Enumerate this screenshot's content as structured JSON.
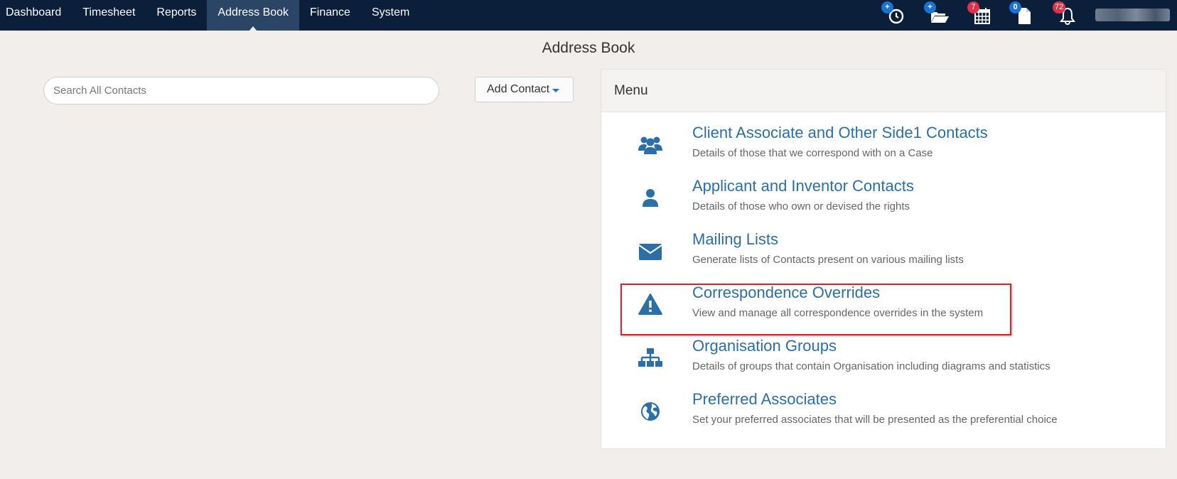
{
  "nav": {
    "items": [
      {
        "label": "Dashboard"
      },
      {
        "label": "Timesheet"
      },
      {
        "label": "Reports"
      },
      {
        "label": "Address Book",
        "active": true
      },
      {
        "label": "Finance"
      },
      {
        "label": "System"
      }
    ]
  },
  "tools": [
    {
      "icon": "history-clock-icon",
      "badge": "+",
      "badge_color": "#1a73d2"
    },
    {
      "icon": "folder-open-icon",
      "badge": "+",
      "badge_color": "#1a73d2"
    },
    {
      "icon": "calendar-icon",
      "badge": "7",
      "badge_color": "#e0304a"
    },
    {
      "icon": "document-icon",
      "badge": "0",
      "badge_color": "#1a73d2"
    },
    {
      "icon": "bell-icon",
      "badge": "72",
      "badge_color": "#e0304a"
    }
  ],
  "page": {
    "title": "Address Book"
  },
  "search": {
    "placeholder": "Search All Contacts",
    "value": ""
  },
  "add_contact": {
    "label": "Add Contact"
  },
  "menu": {
    "heading": "Menu",
    "items": [
      {
        "icon": "users-group-icon",
        "title": "Client Associate and Other Side1 Contacts",
        "description": "Details of those that we correspond with on a Case"
      },
      {
        "icon": "user-icon",
        "title": "Applicant and Inventor Contacts",
        "description": "Details of those who own or devised the rights"
      },
      {
        "icon": "envelope-icon",
        "title": "Mailing Lists",
        "description": "Generate lists of Contacts present on various mailing lists"
      },
      {
        "icon": "warning-icon",
        "title": "Correspondence Overrides",
        "description": "View and manage all correspondence overrides in the system",
        "highlighted": true
      },
      {
        "icon": "sitemap-icon",
        "title": "Organisation Groups",
        "description": "Details of groups that contain Organisation including diagrams and statistics"
      },
      {
        "icon": "globe-icon",
        "title": "Preferred Associates",
        "description": "Set your preferred associates that will be presented as the preferential choice"
      }
    ]
  },
  "colors": {
    "topbar": "#0b1f3a",
    "active_tab": "#2b4566",
    "link": "#2a6fa8",
    "highlight_border": "#d8232a"
  }
}
